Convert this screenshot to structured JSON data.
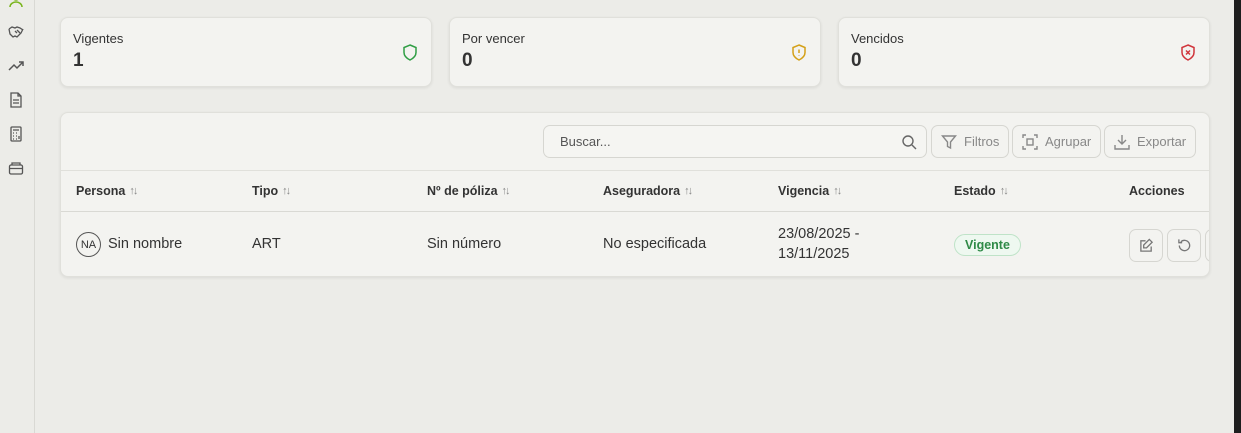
{
  "sidebar": {
    "icons": [
      "user-icon",
      "handshake-icon",
      "trending-up-icon",
      "document-icon",
      "calculator-icon",
      "package-icon"
    ]
  },
  "stats": [
    {
      "label": "Vigentes",
      "value": "1",
      "icon": "shield-check-icon",
      "color": "#2f9e44"
    },
    {
      "label": "Por vencer",
      "value": "0",
      "icon": "shield-alert-icon",
      "color": "#d4a017"
    },
    {
      "label": "Vencidos",
      "value": "0",
      "icon": "shield-x-icon",
      "color": "#d0343b"
    }
  ],
  "toolbar": {
    "search_placeholder": "Buscar...",
    "filters_label": "Filtros",
    "group_label": "Agrupar",
    "export_label": "Exportar"
  },
  "table": {
    "columns": [
      "Persona",
      "Tipo",
      "Nº de póliza",
      "Aseguradora",
      "Vigencia",
      "Estado",
      "Acciones"
    ],
    "rows": [
      {
        "avatar": "NA",
        "persona": "Sin nombre",
        "tipo": "ART",
        "poliza": "Sin número",
        "aseguradora": "No especificada",
        "vigencia_start": "23/08/2025 -",
        "vigencia_end": "13/11/2025",
        "estado": "Vigente"
      }
    ]
  },
  "colors": {
    "accent_green": "#2f8a47",
    "background": "#ecece8"
  }
}
